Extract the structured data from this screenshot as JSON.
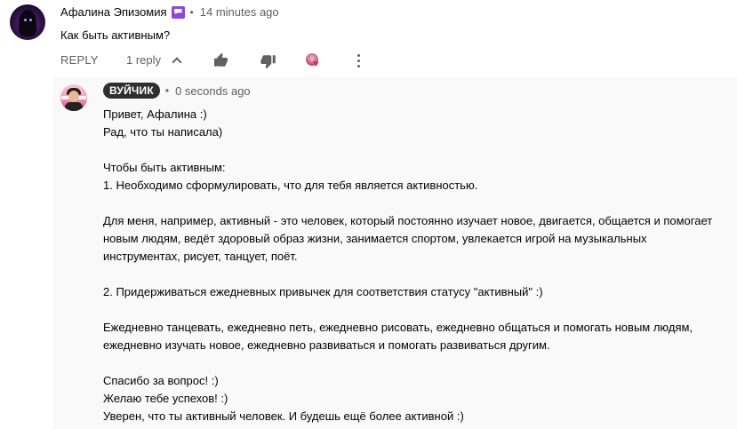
{
  "parent_comment": {
    "author": "Афалина Эпизомия",
    "separator": "•",
    "timestamp": "14 minutes ago",
    "text": "Как быть активным?",
    "actions": {
      "reply_label": "REPLY",
      "replies_toggle_label": "1 reply",
      "like_icon": "thumb-up-icon",
      "dislike_icon": "thumb-down-icon",
      "hearted_icon": "creator-heart-icon",
      "more_icon": "more-vert-icon"
    }
  },
  "reply": {
    "author": "ВУЙЧИК",
    "separator": "•",
    "timestamp": "0 seconds ago",
    "lines": [
      "Привет, Афалина :)",
      "Рад, что ты написала)",
      "",
      "Чтобы быть активным:",
      "1. Необходимо сформулировать, что для тебя является активностью.",
      "",
      "Для меня, например, активный - это человек, который постоянно изучает новое, двигается, общается и помогает",
      "новым людям, ведёт здоровый образ жизни, занимается спортом, увлекается игрой на музыкальных",
      "инструментах, рисует, танцует, поёт.",
      "",
      "2. Придерживаться ежедневных привычек для соответствия статусу \"активный\" :)",
      "",
      "Ежедневно танцевать, ежедневно петь, ежедневно рисовать, ежедневно общаться и помогать новым людям,",
      "ежедневно изучать новое, ежедневно развиваться и помогать развиваться другим.",
      "",
      "Спасибо за вопрос! :)",
      "Желаю тебе успехов! :)",
      "Уверен, что ты активный человек. И будешь ещё более активной :)"
    ]
  },
  "colors": {
    "member_badge": "#9146d8",
    "owner_chip_bg": "#2f2f2f",
    "reply_bg": "#f9f9f9",
    "secondary_text": "#606060"
  }
}
